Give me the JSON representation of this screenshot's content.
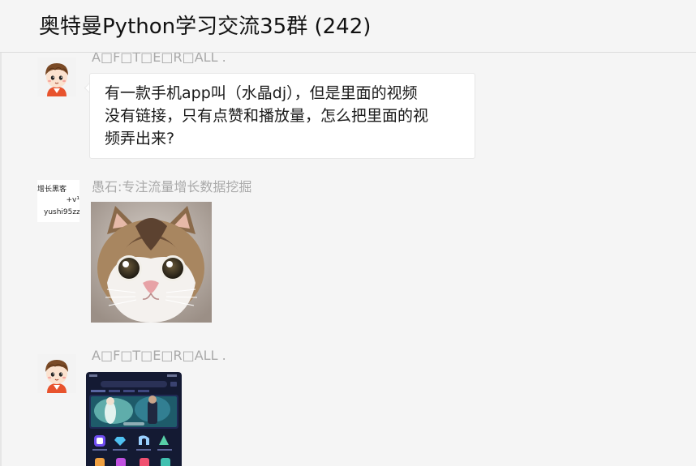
{
  "chat": {
    "title": "奥特曼Python学习交流35群 (242)"
  },
  "messages": [
    {
      "sender": "A□F□T□E□R□ALL .",
      "avatar_icon": "cartoon-boy-avatar-icon",
      "lines": [
        "有一款手机app叫（水晶dj），但是里面的视频",
        "没有链接，只有点赞和播放量，怎么把里面的视",
        "频弄出来?"
      ]
    },
    {
      "sender": "愚石:专注流量增长数据挖掘",
      "avatar_icon": "growth-hacker-card-avatar-icon",
      "avatar_text": {
        "line1": "增长黑客",
        "line2": "+v¹",
        "line3": "yushi95zz"
      },
      "image_icon": "surprised-cat-sticker-icon"
    },
    {
      "sender": "A□F□T□E□R□ALL .",
      "avatar_icon": "cartoon-boy-avatar-icon",
      "image_icon": "phone-app-screenshot-icon"
    }
  ],
  "colors": {
    "background": "#f5f5f5",
    "bubble": "#ffffff",
    "sender_text": "#a9a9a9",
    "title_text": "#111111"
  }
}
